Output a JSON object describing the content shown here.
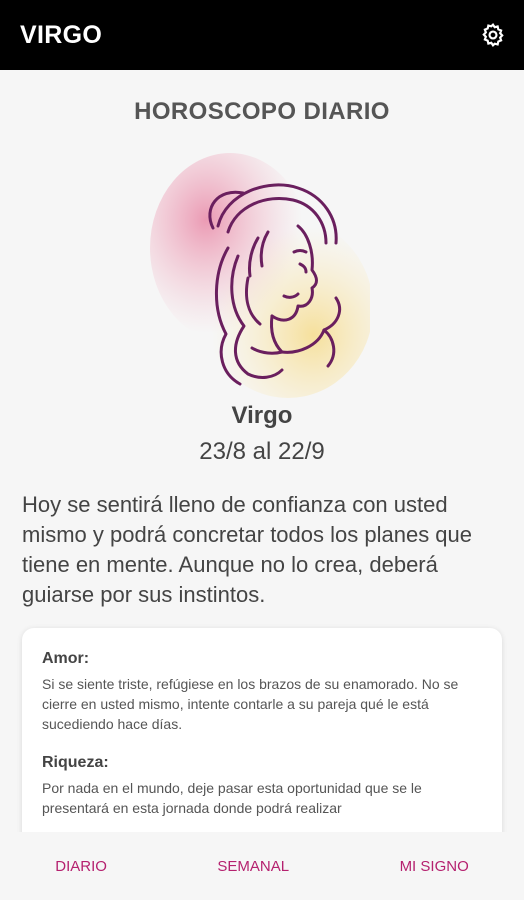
{
  "appbar": {
    "title": "VIRGO",
    "settings_icon": "gear-icon"
  },
  "main": {
    "section_title": "HOROSCOPO DIARIO",
    "sign_name": "Virgo",
    "sign_dates": "23/8 al 22/9",
    "summary": "Hoy se sentirá lleno de confianza con usted mismo y podrá concretar todos los planes que tiene en mente. Aunque no lo crea, deberá guiarse por sus instintos."
  },
  "card": {
    "sections": [
      {
        "title": "Amor:",
        "text": "Si se siente triste, refúgiese en los brazos de su enamorado. No se cierre en usted mismo, intente contarle a su pareja qué le está sucediendo hace días."
      },
      {
        "title": "Riqueza:",
        "text": "Por nada en el mundo, deje pasar esta oportunidad que se le presentará en esta jornada donde podrá realizar"
      }
    ]
  },
  "bottom_nav": {
    "items": [
      {
        "label": "DIARIO"
      },
      {
        "label": "SEMANAL"
      },
      {
        "label": "MI SIGNO"
      }
    ]
  },
  "colors": {
    "appbar": "#000000",
    "accent": "#b5216f",
    "illustration_line": "#6a1f5e"
  }
}
